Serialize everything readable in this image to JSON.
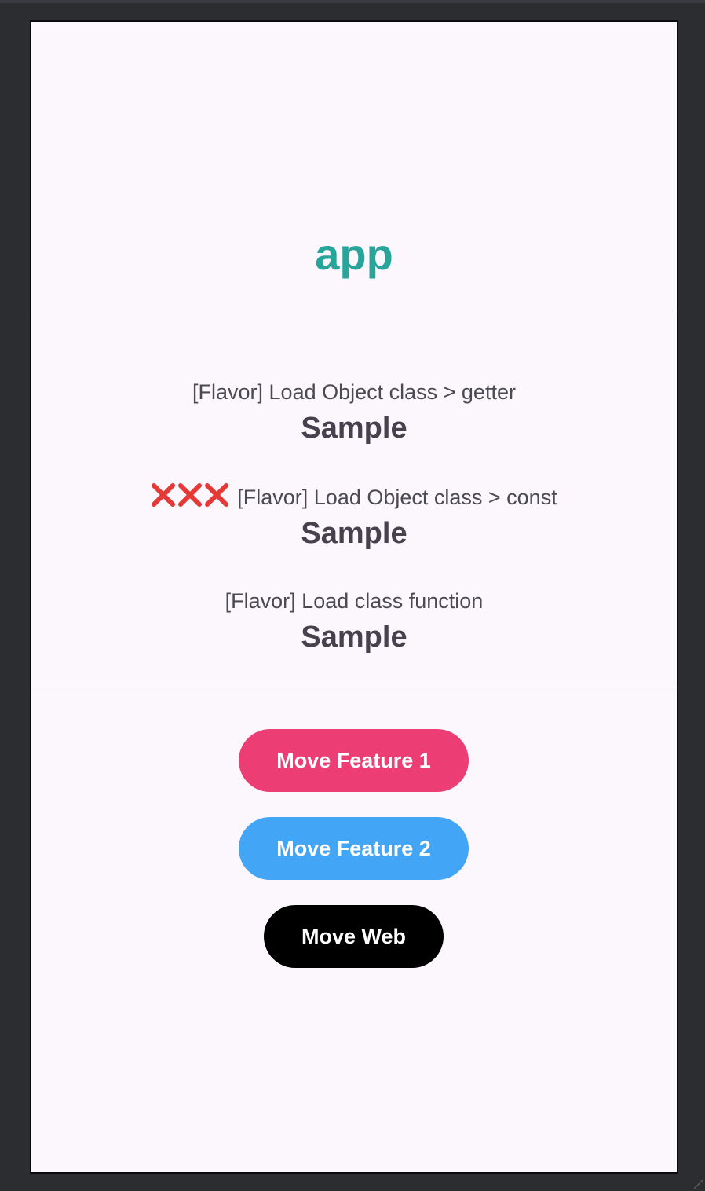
{
  "app": {
    "title": "app"
  },
  "items": [
    {
      "label": "[Flavor] Load Object class > getter",
      "value": "Sample"
    },
    {
      "prefix_icon": "red-cross-x3",
      "label": "[Flavor] Load Object class > const",
      "value": "Sample"
    },
    {
      "label": "[Flavor] Load class function",
      "value": "Sample"
    }
  ],
  "buttons": {
    "feature1": "Move Feature 1",
    "feature2": "Move Feature 2",
    "web": "Move Web"
  },
  "colors": {
    "title": "#26a69a",
    "feature1_button": "#ec3d75",
    "feature2_button": "#42a5f5",
    "web_button": "#000000",
    "background": "#fcf6fd",
    "cross": "#e53935"
  }
}
